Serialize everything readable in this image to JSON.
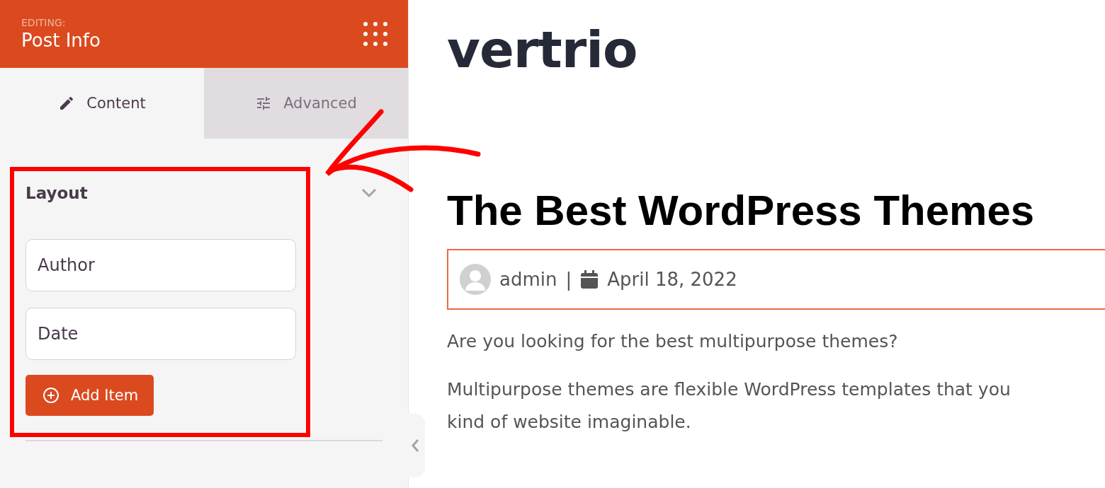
{
  "sidebar": {
    "header": {
      "label": "EDITING:",
      "title": "Post Info"
    },
    "tabs": [
      {
        "label": "Content",
        "kind": "content",
        "selected": true
      },
      {
        "label": "Advanced",
        "kind": "advanced",
        "selected": false
      }
    ],
    "section": {
      "title": "Layout",
      "items": [
        "Author",
        "Date"
      ],
      "add_button": "Add Item"
    }
  },
  "preview": {
    "logo": "vertrio",
    "title": "The Best WordPress Themes",
    "meta": {
      "author": "admin",
      "separator": "|",
      "date": "April 18, 2022"
    },
    "paragraphs": [
      [
        "Are you looking for the best multipurpose themes?"
      ],
      [
        "Multipurpose themes are flexible WordPress templates that you",
        "kind of website imaginable."
      ]
    ]
  }
}
